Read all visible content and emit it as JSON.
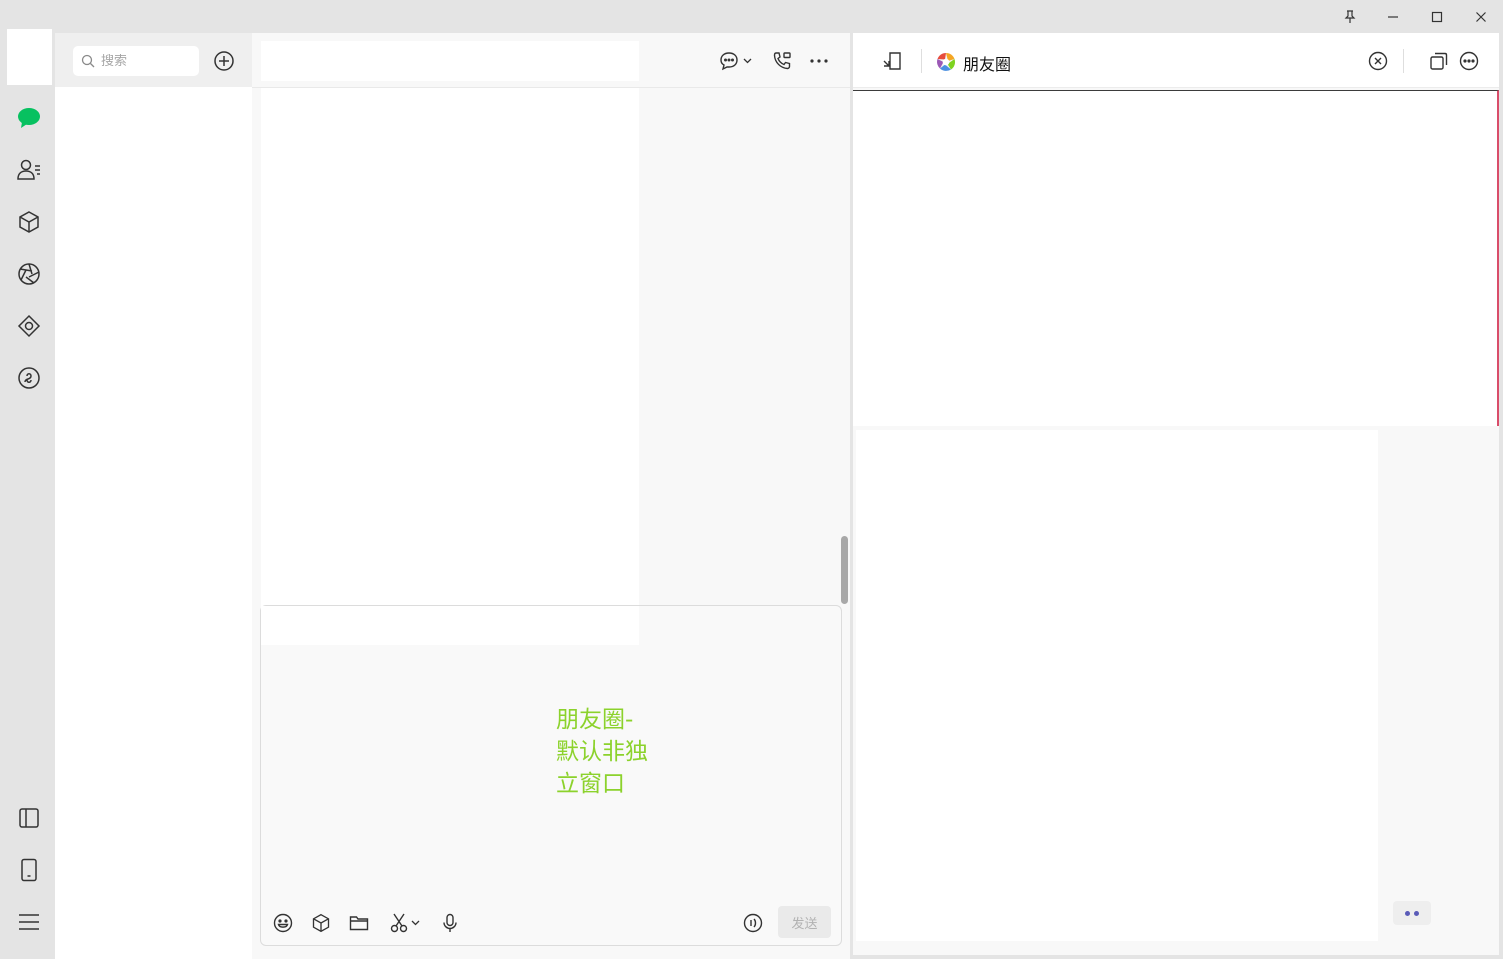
{
  "colors": {
    "accent_green": "#07c160",
    "overlay_label": "#8cd22c",
    "icon_gray": "#333333"
  },
  "titlebar": {
    "buttons": [
      "pin-icon",
      "minimize-icon",
      "maximize-icon",
      "close-icon"
    ]
  },
  "left_nav": {
    "items": [
      "chat-icon",
      "contacts-icon",
      "favorites-icon",
      "moments-icon",
      "mini-programs-icon",
      "channels-icon"
    ],
    "bottom_items": [
      "toggle-panel-icon",
      "phone-icon",
      "menu-icon"
    ]
  },
  "search": {
    "placeholder": "搜索",
    "value": ""
  },
  "chat": {
    "header_icons": [
      "comment-icon",
      "voice-call-icon",
      "more-icon"
    ],
    "toolbar_icons": [
      "emoji-icon",
      "favorites-icon",
      "folder-icon",
      "screenshot-icon",
      "microphone-icon",
      "voice-input-icon"
    ],
    "send_label": "发送",
    "overlay_label": "朋友圈-\n默认非独\n立窗口"
  },
  "moments": {
    "title": "朋友圈",
    "header_icons": [
      "pop-out-icon",
      "moments-logo-icon",
      "close-circle-icon",
      "multi-window-icon",
      "more-circle-icon"
    ]
  }
}
